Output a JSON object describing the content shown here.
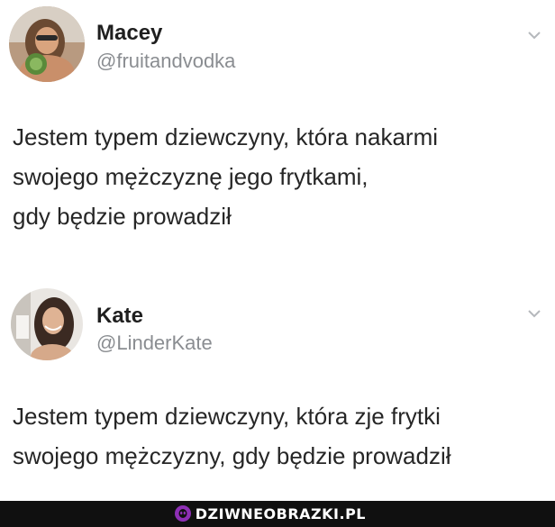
{
  "tweets": [
    {
      "display_name": "Macey",
      "handle": "@fruitandvodka",
      "avatar_icon": "profile-photo-macey",
      "menu_icon": "chevron-down-icon",
      "text_lines": [
        "Jestem typem dziewczyny, która nakarmi",
        "swojego mężczyznę jego frytkami,",
        "gdy będzie prowadził"
      ]
    },
    {
      "display_name": "Kate",
      "handle": "@LinderKate",
      "avatar_icon": "profile-photo-kate",
      "menu_icon": "chevron-down-icon",
      "text_lines": [
        "Jestem typem dziewczyny, która zje frytki",
        "swojego mężczyzny, gdy będzie prowadził"
      ]
    }
  ],
  "watermark": {
    "text": "DZIWNEOBRAZKI.PL",
    "logo_icon": "alien-face-icon",
    "bar_color": "#101010",
    "logo_color": "#8e2fb5"
  },
  "colors": {
    "background": "#ffffff",
    "name_color": "#1f1f1f",
    "handle_color": "#8a8d91",
    "text_color": "#262626"
  }
}
